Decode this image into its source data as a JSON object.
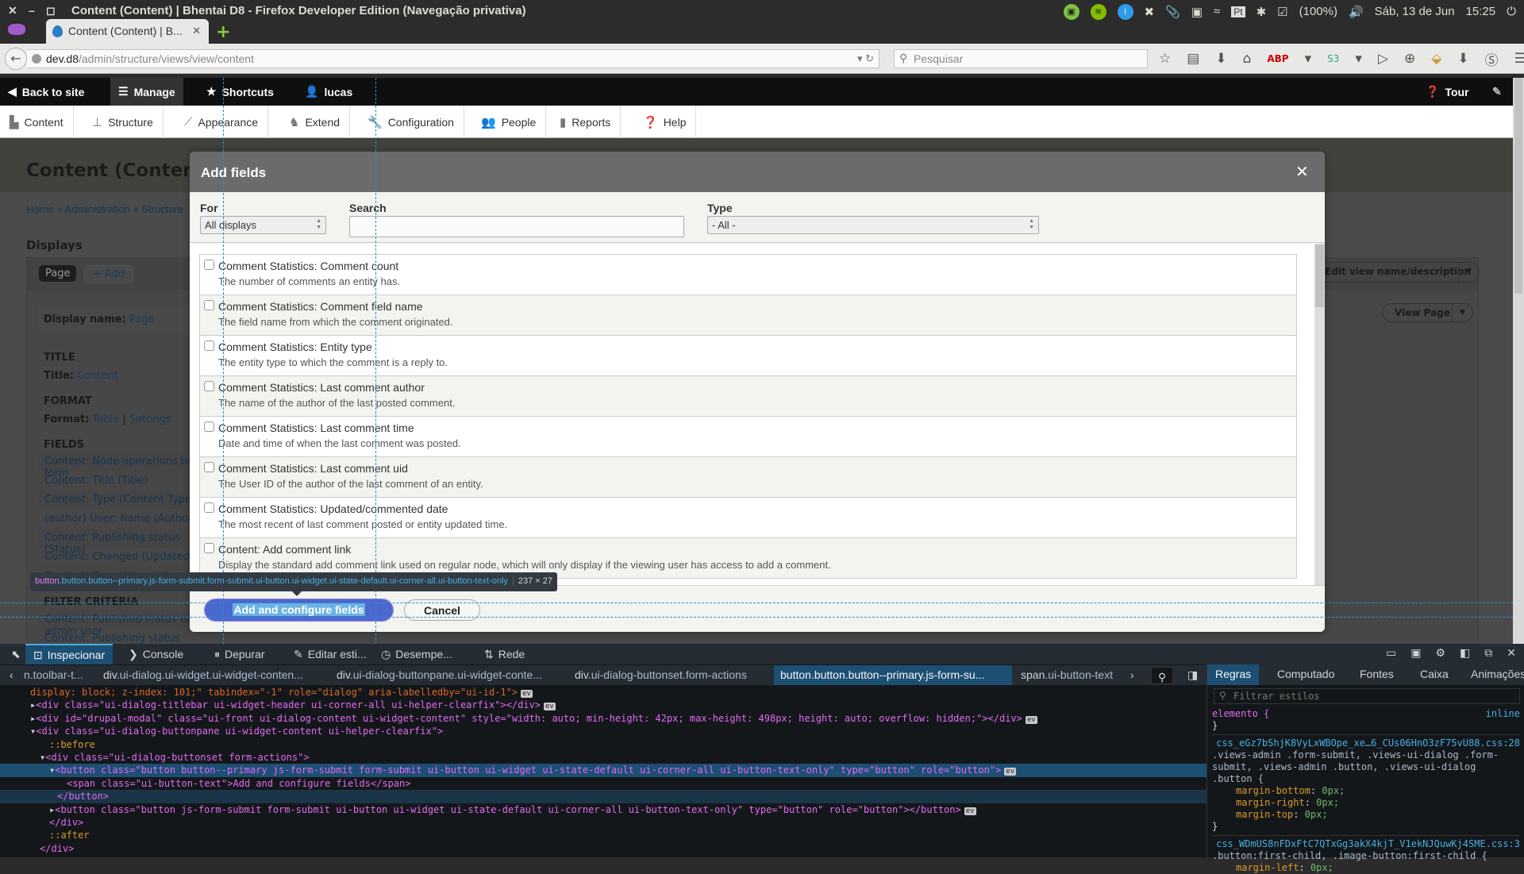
{
  "os": {
    "window_title": "Content (Content) | Bhentai D8 - Firefox Developer Edition (Navegação privativa)",
    "tray": {
      "battery": "(100%)",
      "date": "Sáb, 13 de Jun",
      "time": "15:25",
      "keyboard": "Pt"
    }
  },
  "browser": {
    "tab_title": "Content (Content) | B...",
    "url_host": "dev.d8",
    "url_path": "/admin/structure/views/view/content",
    "search_placeholder": "Pesquisar"
  },
  "drupal_toolbar": {
    "back_to_site": "Back to site",
    "manage": "Manage",
    "shortcuts": "Shortcuts",
    "user": "lucas",
    "tour": "Tour",
    "tray_items": [
      {
        "label": "Content",
        "icon": "page-icon"
      },
      {
        "label": "Structure",
        "icon": "sitemap-icon"
      },
      {
        "label": "Appearance",
        "icon": "brush-icon"
      },
      {
        "label": "Extend",
        "icon": "puzzle-icon"
      },
      {
        "label": "Configuration",
        "icon": "wrench-icon"
      },
      {
        "label": "People",
        "icon": "people-icon"
      },
      {
        "label": "Reports",
        "icon": "bar-chart-icon"
      },
      {
        "label": "Help",
        "icon": "help-icon"
      }
    ]
  },
  "page": {
    "title": "Content (Content)",
    "breadcrumb": "Home » Administration » Structure",
    "displays_heading": "Displays",
    "page_tab": "Page",
    "add_button": "+ Add",
    "edit_view_button": "Edit view name/description",
    "view_page_button": "View Page",
    "display_name_label": "Display name:",
    "display_name_value": "Page",
    "title_section": "TITLE",
    "title_label": "Title:",
    "title_value": "Content",
    "format_section": "FORMAT",
    "format_label": "Format:",
    "format_value": "Table",
    "format_settings": "Settings",
    "fields_section": "FIELDS",
    "fields": [
      "Content: Node operations bulk form",
      "Content: Title (Title)",
      "Content: Type (Content Type)",
      "(author) User: Name (Author)",
      "Content: Publishing status (Status)",
      "Content: Changed (Updated)",
      "Content: Operations links (Operations)"
    ],
    "filter_section": "FILTER CRITERIA",
    "filters": [
      "Content: Published status or admin user",
      "Content: Publishing status (grouped)"
    ]
  },
  "dialog": {
    "title": "Add fields",
    "for_label": "For",
    "for_value": "All displays",
    "search_label": "Search",
    "search_value": "",
    "type_label": "Type",
    "type_value": "- All -",
    "items": [
      {
        "title": "Comment Statistics: Comment count",
        "desc": "The number of comments an entity has.",
        "checked": false
      },
      {
        "title": "Comment Statistics: Comment field name",
        "desc": "The field name from which the comment originated.",
        "checked": false
      },
      {
        "title": "Comment Statistics: Entity type",
        "desc": "The entity type to which the comment is a reply to.",
        "checked": false
      },
      {
        "title": "Comment Statistics: Last comment author",
        "desc": "The name of the author of the last posted comment.",
        "checked": false
      },
      {
        "title": "Comment Statistics: Last comment time",
        "desc": "Date and time of when the last comment was posted.",
        "checked": false
      },
      {
        "title": "Comment Statistics: Last comment uid",
        "desc": "The User ID of the author of the last comment of an entity.",
        "checked": false
      },
      {
        "title": "Comment Statistics: Updated/commented date",
        "desc": "The most recent of last comment posted or entity updated time.",
        "checked": false
      },
      {
        "title": "Content: Add comment link",
        "desc": "Display the standard add comment link used on regular node, which will only display if the viewing user has access to add a comment.",
        "checked": false
      }
    ],
    "primary_button": "Add and configure fields",
    "cancel_button": "Cancel"
  },
  "inspector_tooltip": {
    "tag": "button",
    "classes": ".button.button--primary.js-form-submit.form-submit.ui-button.ui-widget.ui-state-default.ui-corner-all.ui-button-text-only",
    "size": "237 × 27"
  },
  "devtools": {
    "tabs": [
      "Inspecionar",
      "Console",
      "Depurar",
      "Editar esti...",
      "Desempe...",
      "Rede"
    ],
    "breadcrumbs": [
      {
        "tag": "",
        "cls": "n.toolbar-t..."
      },
      {
        "tag": "div",
        "cls": ".ui-dialog.ui-widget.ui-widget-conten..."
      },
      {
        "tag": "div",
        "cls": ".ui-dialog-buttonpane.ui-widget-conte..."
      },
      {
        "tag": "div",
        "cls": ".ui-dialog-buttonset.form-actions"
      },
      {
        "tag": "button",
        "cls": ".button.button--primary.js-form-su..."
      },
      {
        "tag": "span",
        "cls": ".ui-button-text"
      }
    ],
    "markup_lines": [
      "display: block; z-index: 101;\" tabindex=\"-1\" role=\"dialog\" aria-labelledby=\"ui-id-1\">",
      "<div class=\"ui-dialog-titlebar ui-widget-header ui-corner-all ui-helper-clearfix\"></div>",
      "<div id=\"drupal-modal\" class=\"ui-front ui-dialog-content ui-widget-content\" style=\"width: auto; min-height: 42px; max-height: 498px; height: auto; overflow: hidden;\"></div>",
      "<div class=\"ui-dialog-buttonpane ui-widget-content ui-helper-clearfix\">",
      "::before",
      "<div class=\"ui-dialog-buttonset form-actions\">",
      "<button class=\"button button--primary js-form-submit form-submit ui-button ui-widget ui-state-default ui-corner-all ui-button-text-only\" type=\"button\" role=\"button\">",
      "<span class=\"ui-button-text\">Add and configure fields</span>",
      "</button>",
      "<button class=\"button js-form-submit form-submit ui-button ui-widget ui-state-default ui-corner-all ui-button-text-only\" type=\"button\" role=\"button\"></button>",
      "</div>",
      "::after",
      "</div>"
    ],
    "rules_tabs": [
      "Regras",
      "Computado",
      "Fontes",
      "Caixa",
      "Animações"
    ],
    "rules_filter_placeholder": "Filtrar estilos",
    "rules": {
      "element_selector": "elemento {",
      "element_source": "inline",
      "close": "}",
      "rule1_source": "css_eGz7bShjK8VyLxWBOpe_xe…6_CUs06HnO3zF75vU88.css:28",
      "rule1_selector": ".views-admin .form-submit, .views-ui-dialog .form-submit, .views-admin .button, .views-ui-dialog .button {",
      "rule1_props": [
        {
          "name": "margin-bottom",
          "value": "0px;"
        },
        {
          "name": "margin-right",
          "value": "0px;"
        },
        {
          "name": "margin-top",
          "value": "0px;"
        }
      ],
      "rule2_source": "css_WDmUS8nFDxFtC7QTxGg3akX4kjT_V1ekNJQuwKj4SME.css:3",
      "rule2_selector": ".button:first-child, .image-button:first-child {",
      "rule2_prop": {
        "name": "margin-left",
        "value": "0px;"
      }
    }
  }
}
